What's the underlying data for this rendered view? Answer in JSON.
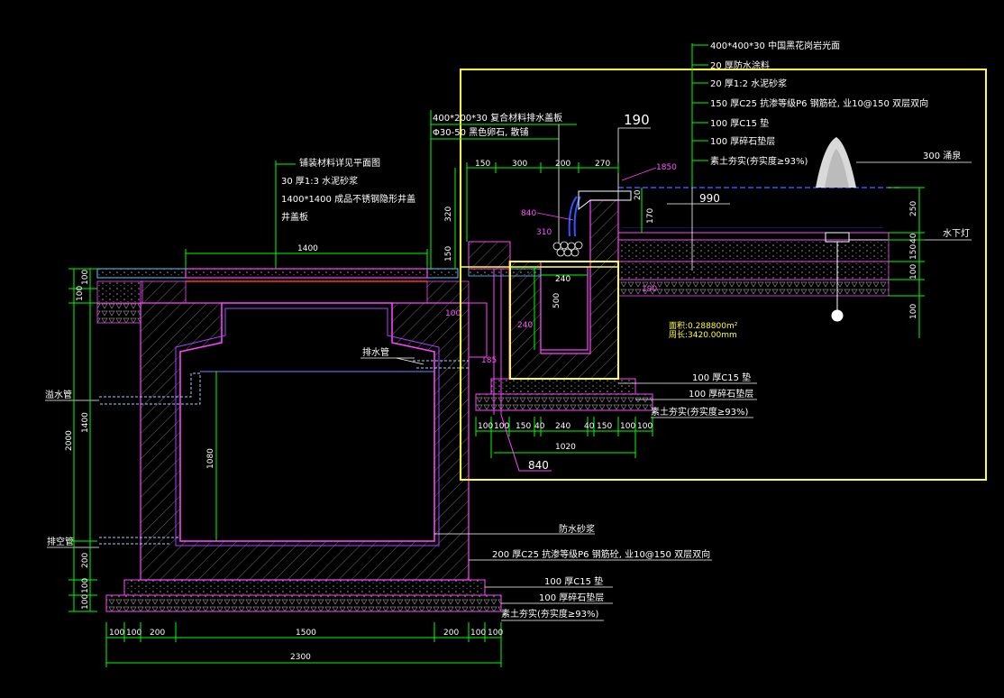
{
  "colors": {
    "background": "#000000",
    "outline": "#ff44ff",
    "dimension": "#00ff00",
    "hatch": "#777777",
    "highlight": "#ffff33",
    "water": "#3355ff",
    "pipe": "#aaccff",
    "leader": "#ffffff"
  },
  "left_section": {
    "callout_paving": [
      "铺装材料详见平面图",
      "30  厚1:3  水泥砂浆",
      "1400*1400     成品不锈钢隐形井盖",
      "井盖板"
    ],
    "dim_top_1400": "1400",
    "label_drain_pipe": "排水管",
    "label_overflow_pipe": "溢水管",
    "label_empty_pipe": "排空管",
    "label_waterproof": "防水砂浆",
    "label_wall": "200   厚C25  抗渗等级P6 钢筋砼, 业10@150   双层双向",
    "label_c15": "100   厚C15  垫",
    "label_gravel": "100   厚碎石垫层",
    "label_soil": "素土夯实(夯实度≥93%)",
    "dim_inner_height": "1080",
    "left_dims": [
      "100",
      "100",
      "1400",
      "2000",
      "200",
      "100",
      "100"
    ],
    "bottom_dims": [
      "100",
      "100",
      "200",
      "1500",
      "200",
      "100",
      "100"
    ],
    "dim_total": "2300"
  },
  "right_section": {
    "callout_top": [
      "400*400*30      中国黑花岗岩光面",
      "20  厚防水涂料",
      "20  厚1:2  水泥砂浆",
      "150  厚C25  抗渗等级P6 钢筋砼, 业10@150    双层双向",
      "100  厚C15  垫",
      "100  厚碎石垫层",
      "素土夯实(夯实度≥93%)"
    ],
    "callout_cover": [
      "400*200*30        复合材料排水盖板",
      "Φ30-50    黑色卵石, 散铺"
    ],
    "label_190": "190",
    "label_1850": "1850",
    "label_990": "990",
    "label_840_small": "840",
    "label_310": "310",
    "top_dims": [
      "150",
      "300",
      "200",
      "270"
    ],
    "dim_20": "20",
    "dim_170": "170",
    "dim_320": "320",
    "dim_150": "150",
    "dim_240": "240",
    "dim_500": "500",
    "dim_100": "100",
    "dim_240b": "240",
    "dim_185": "185",
    "dim_190b": "190",
    "label_spring": "300   涌泉",
    "label_light": "水下灯",
    "right_dims": [
      "250",
      "40",
      "150",
      "100",
      "100"
    ],
    "area_text": "面积:0.288800m²",
    "perim_text": "周长:3420.00mm",
    "label_c15": "100   厚C15  垫",
    "label_gravel": "100   厚碎石垫层",
    "label_soil": "素土夯实(夯实度≥93%)",
    "bottom_dims": [
      "100",
      "100",
      "150",
      "40",
      "240",
      "40",
      "150",
      "100",
      "100"
    ],
    "dim_1020": "1020",
    "label_840_box": "840"
  }
}
